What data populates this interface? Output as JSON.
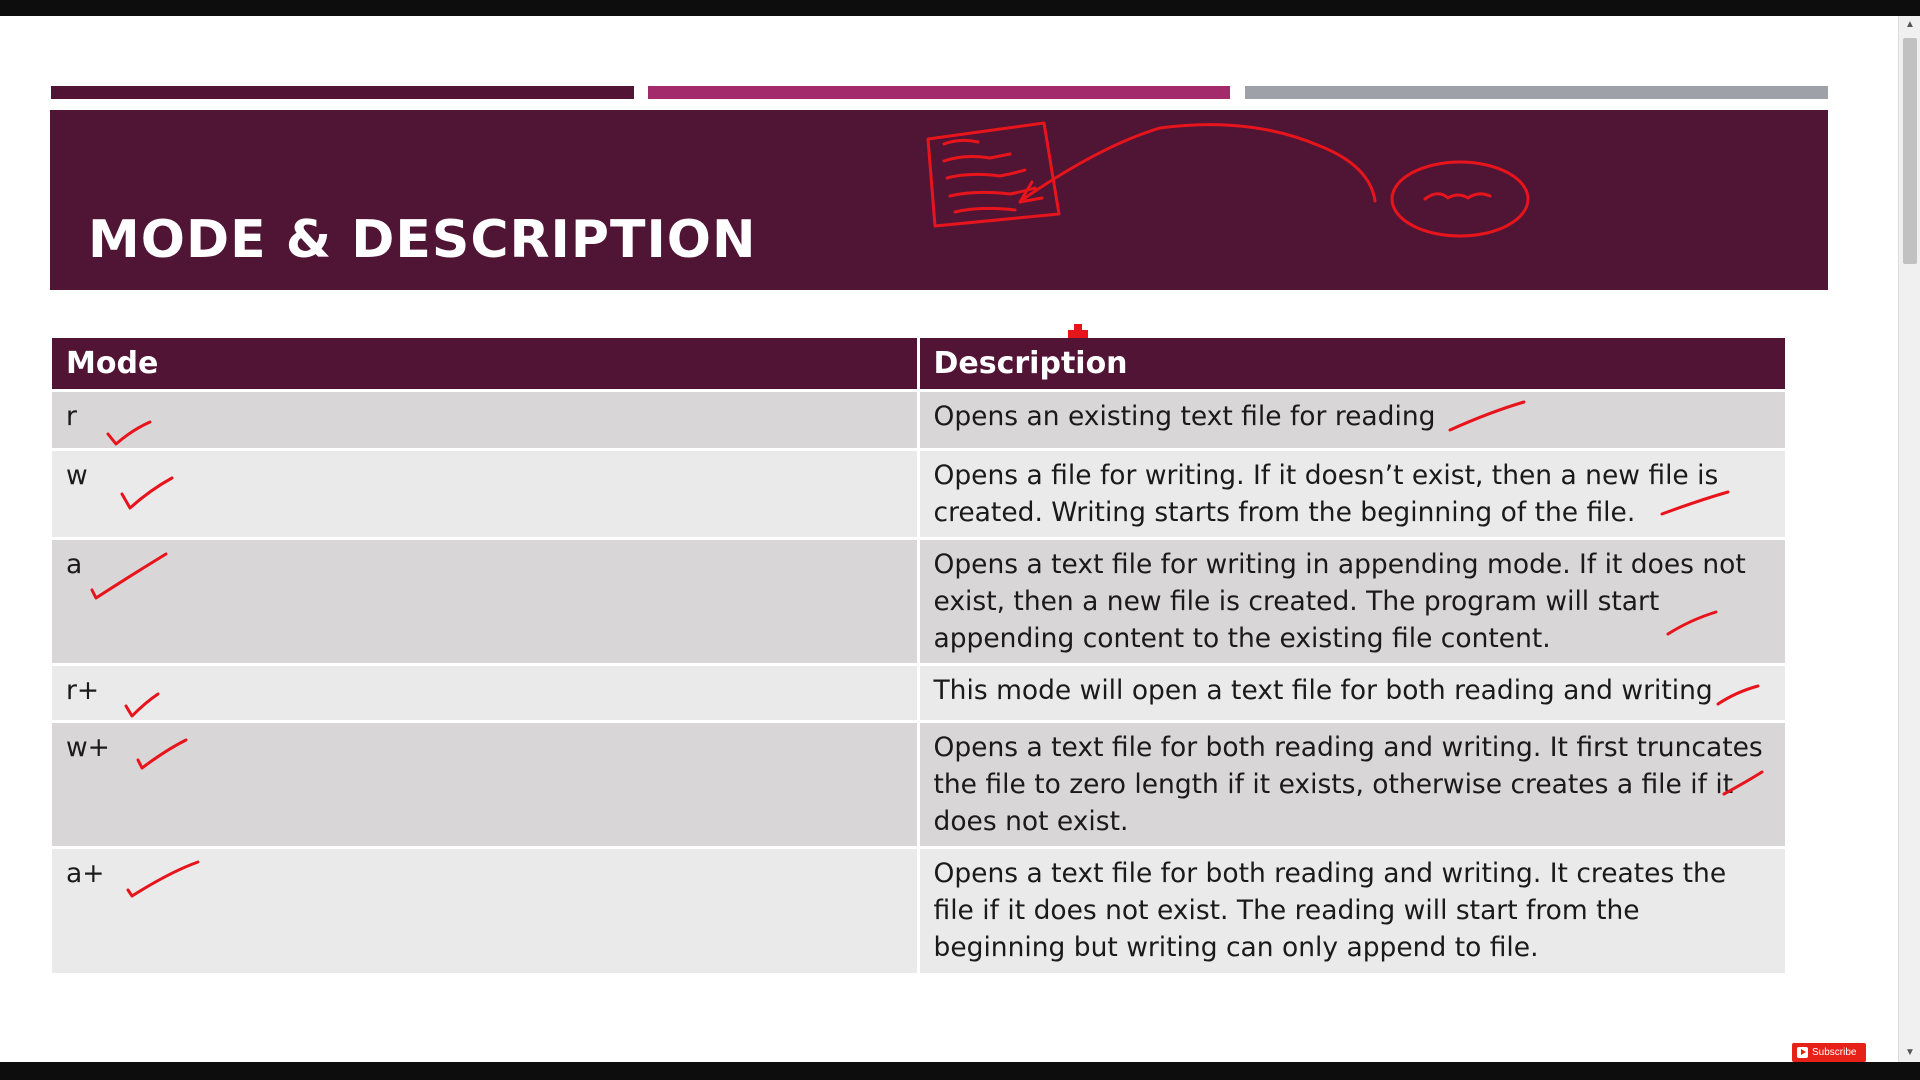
{
  "slide": {
    "title": "MODE & DESCRIPTION"
  },
  "table": {
    "headers": [
      "Mode",
      "Description"
    ],
    "rows": [
      {
        "mode": "r",
        "description": "Opens an existing text file for reading"
      },
      {
        "mode": "w",
        "description": "Opens a file for writing. If it doesn’t exist, then a new file is created.  Writing starts from the beginning of the file."
      },
      {
        "mode": "a",
        "description": "Opens a text file for writing in appending mode. If it does not exist, then a new file is created. The program will start appending content to the existing file content."
      },
      {
        "mode": "r+",
        "description": "This mode will open a text file for both reading and writing"
      },
      {
        "mode": "w+",
        "description": "Opens a text file for both reading and writing. It first truncates the file to zero length if it exists, otherwise creates a file if it does not exist."
      },
      {
        "mode": "a+",
        "description": "Opens a text file for both reading and writing. It creates the file if it does not exist. The reading will start from the beginning but writing can only append to file."
      }
    ]
  },
  "overlay": {
    "subscribe_label": "Subscribe"
  },
  "colors": {
    "title_band": "#501434",
    "accent_dark": "#521435",
    "accent_magenta": "#a32a6b",
    "accent_gray": "#9ea2a8",
    "ink_red": "#e8141c",
    "row_odd": "#d9d6d8",
    "row_even": "#ebeaeb"
  }
}
